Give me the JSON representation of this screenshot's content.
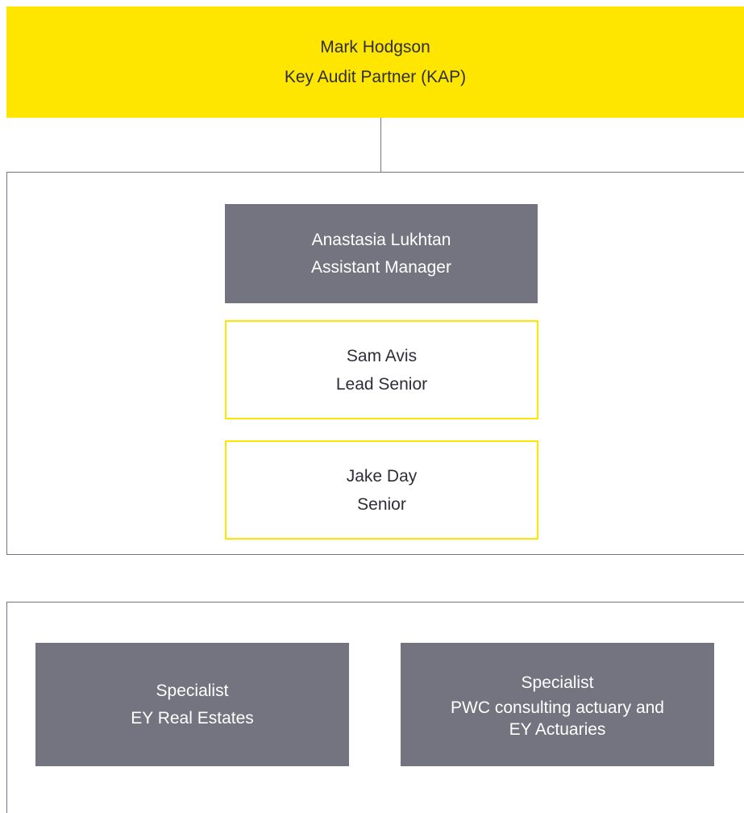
{
  "kap": {
    "name": "Mark Hodgson",
    "role": "Key Audit Partner (KAP)"
  },
  "team": [
    {
      "name": "Anastasia Lukhtan",
      "role": "Assistant Manager"
    },
    {
      "name": "Sam Avis",
      "role": "Lead Senior"
    },
    {
      "name": "Jake Day",
      "role": "Senior"
    }
  ],
  "specialists": [
    {
      "title": "Specialist",
      "role_line1": "EY Real Estates",
      "role_line2": ""
    },
    {
      "title": "Specialist",
      "role_line1": "PWC consulting actuary and",
      "role_line2": "EY Actuaries"
    }
  ],
  "colors": {
    "ey_yellow": "#FFE600",
    "grey": "#747480",
    "dark_text": "#2E2E38"
  }
}
